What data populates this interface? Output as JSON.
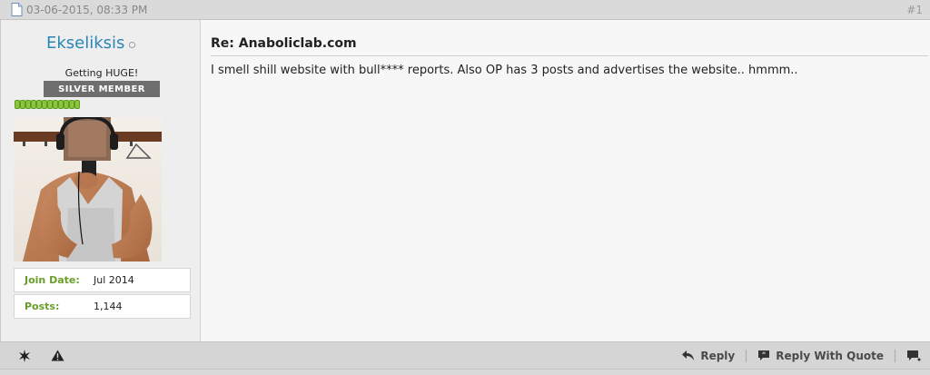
{
  "post": {
    "date": "03-06-2015, 08:33 PM",
    "number": "#1",
    "title": "Re: Anaboliclab.com",
    "message": "I smell shill website with bull**** reports. Also OP has 3 posts and advertises the website.. hmmm.."
  },
  "user": {
    "username": "Ekseliksis",
    "title": "Getting HUGE!",
    "rank": "SILVER MEMBER",
    "reputation_pips": 12,
    "stats": [
      {
        "label": "Join Date:",
        "value": "Jul 2014"
      },
      {
        "label": "Posts:",
        "value": "1,144"
      }
    ]
  },
  "footer": {
    "left_icons": [
      "star-icon",
      "warning-icon"
    ],
    "reply_label": "Reply",
    "reply_quote_label": "Reply With Quote"
  },
  "colors": {
    "username": "#2a86b4",
    "stat_label": "#6a9e2a",
    "rank_badge": "#6e6e6e",
    "reputation": "#8cc43c"
  }
}
